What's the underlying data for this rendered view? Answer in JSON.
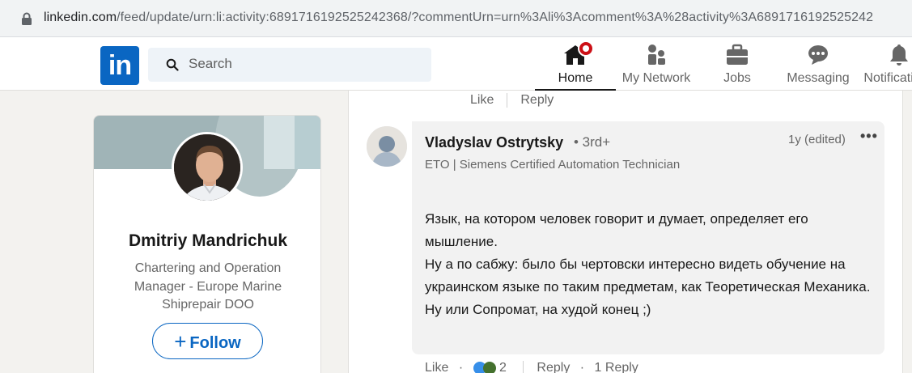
{
  "browser": {
    "url_host": "linkedin.com",
    "url_path": "/feed/update/urn:li:activity:6891716192525242368/?commentUrn=urn%3Ali%3Acomment%3A%28activity%3A6891716192525242"
  },
  "nav": {
    "logo": "in",
    "search_placeholder": "Search",
    "items": [
      {
        "label": "Home",
        "icon": "home-icon",
        "active": true
      },
      {
        "label": "My Network",
        "icon": "network-icon"
      },
      {
        "label": "Jobs",
        "icon": "briefcase-icon"
      },
      {
        "label": "Messaging",
        "icon": "messaging-icon"
      },
      {
        "label": "Notifications",
        "icon": "bell-icon"
      }
    ]
  },
  "profile": {
    "name": "Dmitriy Mandrichuk",
    "headline": "Chartering and Operation Manager - Europe Marine Shiprepair DOO",
    "follow_label": "Follow"
  },
  "parent_actions": {
    "like": "Like",
    "reply": "Reply"
  },
  "comment": {
    "author": "Vladyslav Ostrytsky",
    "degree": "• 3rd+",
    "headline": "ETO | Siemens Certified Automation Technician",
    "time": "1y (edited)",
    "text_lines": [
      "Язык, на котором человек говорит и думает, определяет его мышление.",
      "Ну а по сабжу: было бы чертовски интересно видеть обучение на украинском языке по таким предметам, как Теоретическая Механика. Ну или Сопромат, на худой конец ;)"
    ],
    "like": "Like",
    "reaction_count": "2",
    "reply": "Reply",
    "replies": "1 Reply"
  },
  "colors": {
    "brand": "#0a66c2",
    "notification": "#cc1016"
  }
}
